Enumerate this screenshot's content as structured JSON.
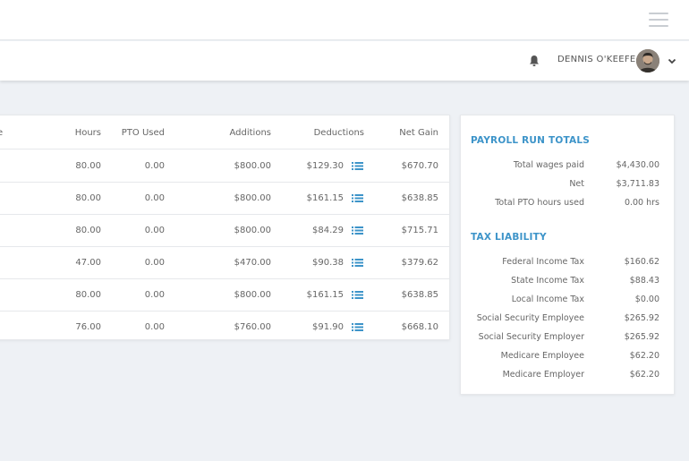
{
  "header": {
    "user_name": "DENNIS O'KEEFE"
  },
  "table": {
    "columns": {
      "name_fragment": "e",
      "hours": "Hours",
      "pto_used": "PTO Used",
      "additions": "Additions",
      "deductions": "Deductions",
      "net_gain": "Net Gain"
    },
    "rows": [
      {
        "hours": "80.00",
        "pto_used": "0.00",
        "additions": "$800.00",
        "deductions": "$129.30",
        "net_gain": "$670.70"
      },
      {
        "hours": "80.00",
        "pto_used": "0.00",
        "additions": "$800.00",
        "deductions": "$161.15",
        "net_gain": "$638.85"
      },
      {
        "hours": "80.00",
        "pto_used": "0.00",
        "additions": "$800.00",
        "deductions": "$84.29",
        "net_gain": "$715.71"
      },
      {
        "hours": "47.00",
        "pto_used": "0.00",
        "additions": "$470.00",
        "deductions": "$90.38",
        "net_gain": "$379.62"
      },
      {
        "hours": "80.00",
        "pto_used": "0.00",
        "additions": "$800.00",
        "deductions": "$161.15",
        "net_gain": "$638.85"
      },
      {
        "hours": "76.00",
        "pto_used": "0.00",
        "additions": "$760.00",
        "deductions": "$91.90",
        "net_gain": "$668.10"
      }
    ]
  },
  "totals": {
    "title": "PAYROLL RUN TOTALS",
    "items": [
      {
        "label": "Total wages paid",
        "value": "$4,430.00"
      },
      {
        "label": "Net",
        "value": "$3,711.83"
      },
      {
        "label": "Total PTO hours used",
        "value": "0.00 hrs"
      }
    ]
  },
  "tax": {
    "title": "TAX LIABILITY",
    "items": [
      {
        "label": "Federal Income Tax",
        "value": "$160.62"
      },
      {
        "label": "State Income Tax",
        "value": "$88.43"
      },
      {
        "label": "Local Income Tax",
        "value": "$0.00"
      },
      {
        "label": "Social Security Employee",
        "value": "$265.92"
      },
      {
        "label": "Social Security Employer",
        "value": "$265.92"
      },
      {
        "label": "Medicare Employee",
        "value": "$62.20"
      },
      {
        "label": "Medicare Employer",
        "value": "$62.20"
      }
    ]
  },
  "colors": {
    "accent": "#3d94c9",
    "icon_blue": "#3d94c9",
    "background": "#eef1f5"
  },
  "icons": {
    "menu": "hamburger-menu-icon",
    "notifications": "bell-icon",
    "user_menu": "chevron-down-icon",
    "deduction_details": "list-icon"
  }
}
